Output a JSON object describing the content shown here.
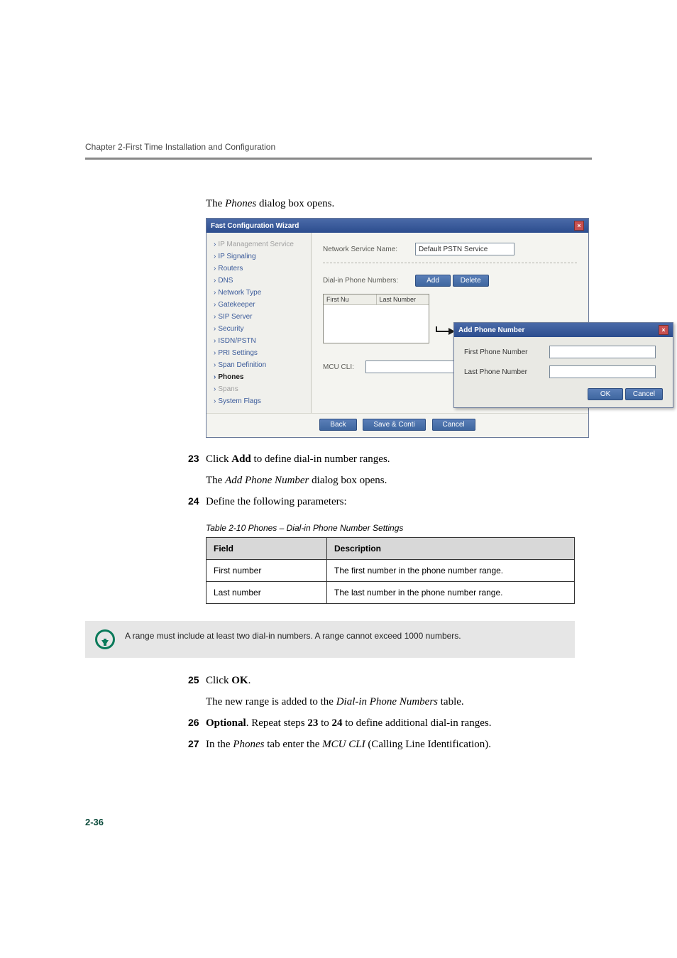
{
  "chapter_header": "Chapter 2-First Time Installation and Configuration",
  "intro_text_prefix": "The ",
  "intro_text_italic": "Phones",
  "intro_text_suffix": " dialog box opens.",
  "dialog": {
    "title": "Fast Configuration Wizard",
    "close_glyph": "×",
    "sidebar": {
      "items": [
        {
          "label": "IP Management Service",
          "state": "disabled"
        },
        {
          "label": "IP Signaling",
          "state": "normal"
        },
        {
          "label": "Routers",
          "state": "normal"
        },
        {
          "label": "DNS",
          "state": "normal"
        },
        {
          "label": "Network Type",
          "state": "normal"
        },
        {
          "label": "Gatekeeper",
          "state": "normal"
        },
        {
          "label": "SIP Server",
          "state": "normal"
        },
        {
          "label": "Security",
          "state": "normal"
        },
        {
          "label": "ISDN/PSTN",
          "state": "normal"
        },
        {
          "label": "PRI Settings",
          "state": "normal"
        },
        {
          "label": "Span Definition",
          "state": "normal"
        },
        {
          "label": "Phones",
          "state": "bold"
        },
        {
          "label": "Spans",
          "state": "disabled"
        },
        {
          "label": "System Flags",
          "state": "normal"
        }
      ]
    },
    "main": {
      "network_service_label": "Network Service Name:",
      "network_service_value": "Default PSTN Service",
      "dialin_label": "Dial-in Phone Numbers:",
      "add_btn": "Add",
      "delete_btn": "Delete",
      "col1": "First Nu",
      "col2": "Last Number",
      "mcu_label": "MCU CLI:"
    },
    "nested": {
      "title": "Add Phone Number",
      "first_label": "First Phone Number",
      "last_label": "Last Phone Number",
      "ok": "OK",
      "cancel": "Cancel"
    },
    "footer": {
      "back": "Back",
      "save": "Save & Conti",
      "cancel": "Cancel"
    }
  },
  "steps": {
    "s23": {
      "num": "23",
      "pre": "Click ",
      "bold": "Add",
      "post": " to define dial-in number ranges."
    },
    "s23_sub_pre": "The ",
    "s23_sub_italic": "Add Phone Number",
    "s23_sub_post": " dialog box opens.",
    "s24": {
      "num": "24",
      "text": "Define the following parameters:"
    },
    "s25": {
      "num": "25",
      "pre": "Click ",
      "bold": "OK",
      "post": "."
    },
    "s25_sub_pre": "The new range is added to the ",
    "s25_sub_italic": "Dial-in Phone Numbers",
    "s25_sub_post": " table.",
    "s26": {
      "num": "26",
      "bold1": "Optional",
      "mid1": ". Repeat steps ",
      "bold2": "23",
      "mid2": " to ",
      "bold3": "24",
      "post": " to define additional dial-in ranges."
    },
    "s27": {
      "num": "27",
      "pre": "In the ",
      "it1": "Phones",
      "mid": " tab enter the ",
      "it2": "MCU CLI",
      "post": " (Calling Line Identification)."
    }
  },
  "param_table": {
    "caption": "Table 2-10  Phones – Dial-in Phone Number Settings",
    "h1": "Field",
    "h2": "Description",
    "r1c1": "First number",
    "r1c2": "The first number in the phone number range.",
    "r2c1": "Last number",
    "r2c2": "The last number in the phone number range."
  },
  "note": "A range must include at least two dial-in numbers. A range cannot exceed 1000 numbers.",
  "page_num": "2-36"
}
